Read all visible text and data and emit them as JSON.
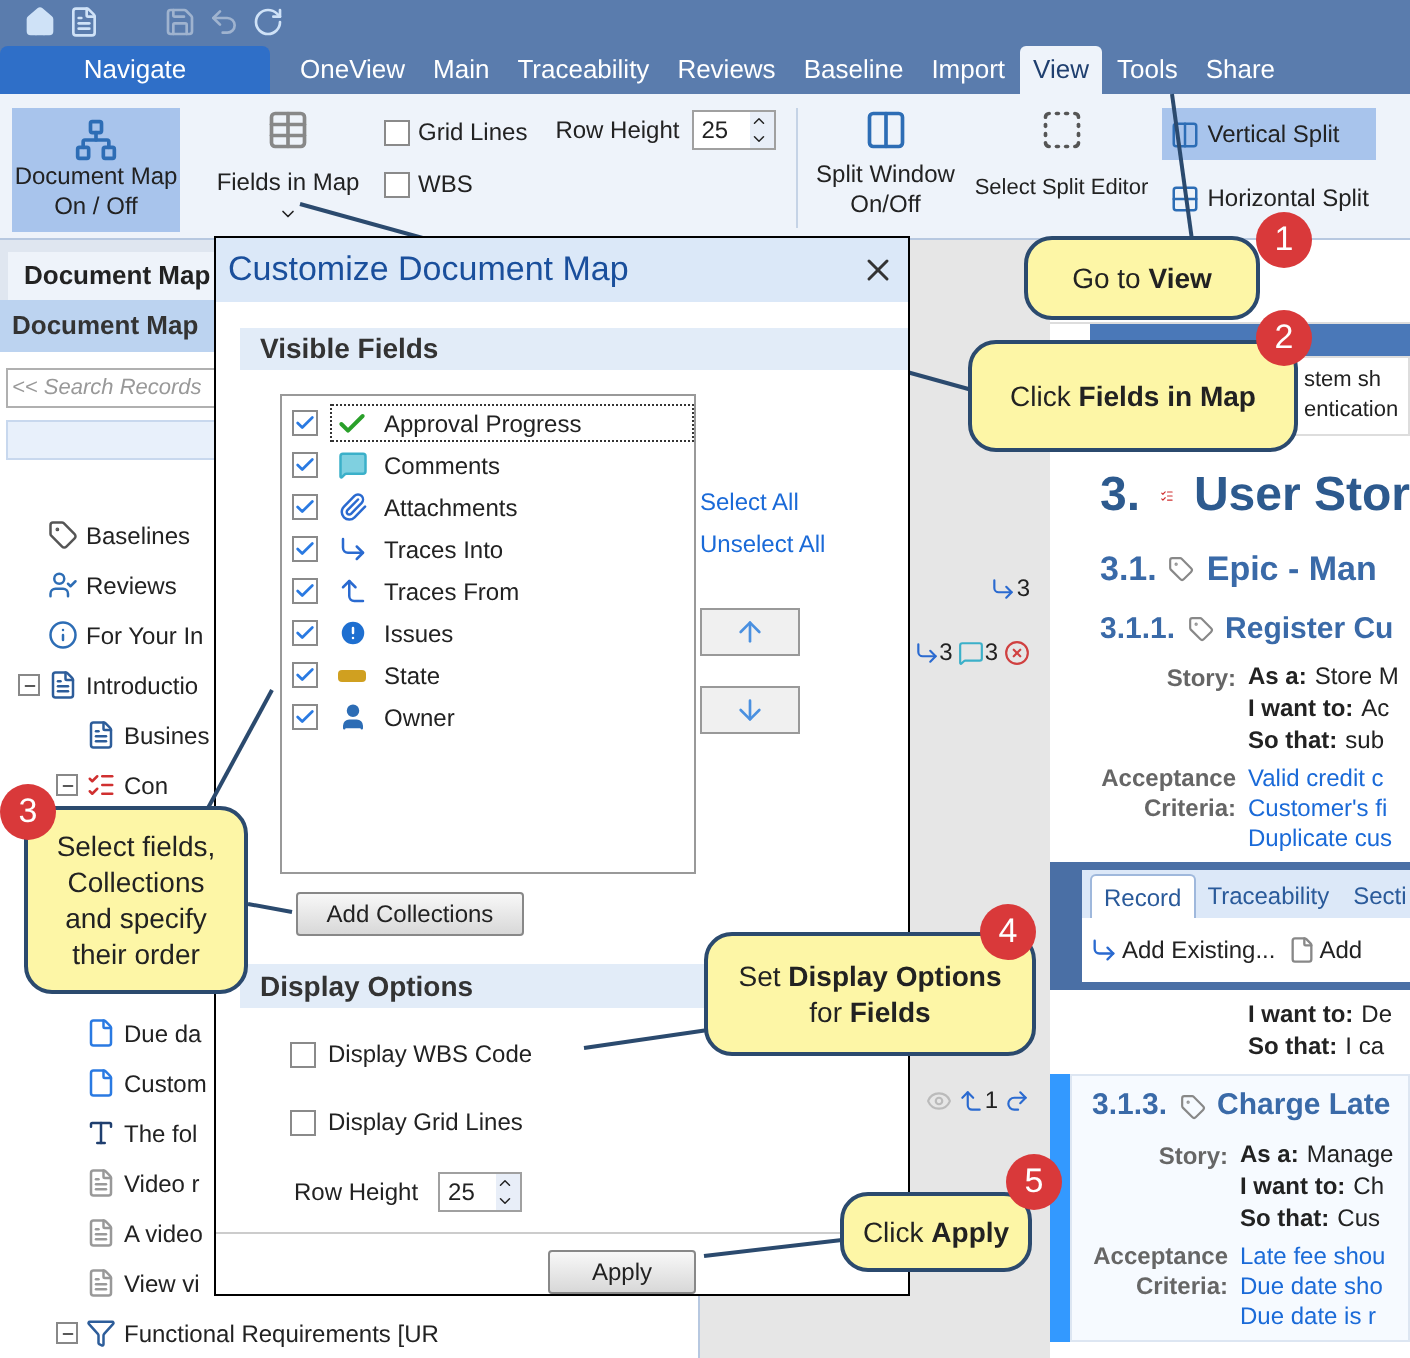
{
  "nav_button": {
    "label": "Navigate"
  },
  "tabs": [
    {
      "label": "OneView",
      "selected": false
    },
    {
      "label": "Main",
      "selected": false
    },
    {
      "label": "Traceability",
      "selected": false
    },
    {
      "label": "Reviews",
      "selected": false
    },
    {
      "label": "Baseline",
      "selected": false
    },
    {
      "label": "Import",
      "selected": false
    },
    {
      "label": "View",
      "selected": true
    },
    {
      "label": "Tools",
      "selected": false
    },
    {
      "label": "Share",
      "selected": false
    }
  ],
  "ribbon": {
    "document_map": {
      "label": "Document Map On / Off",
      "selected": true
    },
    "fields_in_map": {
      "label": "Fields in Map"
    },
    "checkboxes": [
      {
        "label": "Grid Lines",
        "checked": false
      },
      {
        "label": "WBS",
        "checked": false
      }
    ],
    "row_height": {
      "label": "Row Height",
      "value": "25"
    },
    "split_window": {
      "label": "Split Window On/Off"
    },
    "select_split_editor": {
      "label": "Select Split Editor"
    },
    "split_modes": [
      {
        "label": "Vertical Split",
        "selected": true
      },
      {
        "label": "Horizontal Split",
        "selected": false
      }
    ]
  },
  "document_map": {
    "tab": "Document Map",
    "title": "Document Map",
    "search": {
      "placeholder": "<< Search Records"
    },
    "tree_top": [
      {
        "label": "Baselines",
        "kind": "baseline"
      },
      {
        "label": "Reviews",
        "kind": "review"
      },
      {
        "label": "For Your In",
        "kind": "fyi"
      },
      {
        "label": "Introductio",
        "kind": "doc",
        "expanded": true,
        "children": [
          {
            "label": "Busines",
            "kind": "doc"
          },
          {
            "label": "Con",
            "kind": "checklist",
            "expanded": true
          }
        ]
      }
    ],
    "tree_bottom": [
      {
        "label": "Due da",
        "kind": "page"
      },
      {
        "label": "Custom",
        "kind": "page"
      },
      {
        "label": "The fol",
        "kind": "text"
      },
      {
        "label": "Video r",
        "kind": "note"
      },
      {
        "label": "A video",
        "kind": "note"
      },
      {
        "label": "View vi",
        "kind": "note"
      },
      {
        "label": "Functional Requirements [UR",
        "kind": "filter",
        "expanded": true
      }
    ]
  },
  "gutter_rows": [
    {
      "marks": [
        {
          "kind": "traces_into",
          "count": "3"
        }
      ]
    },
    {
      "marks": [
        {
          "kind": "traces_into",
          "count": "3"
        },
        {
          "kind": "comments",
          "count": "3"
        },
        {
          "kind": "refused"
        }
      ]
    },
    {
      "marks": [
        {
          "kind": "viewed"
        },
        {
          "kind": "traces_from",
          "count": "1"
        },
        {
          "kind": "redo"
        }
      ]
    }
  ],
  "document": {
    "table_fragments": [
      "stem sh",
      "entication"
    ],
    "heading": {
      "number": "3.",
      "title": "User Stor"
    },
    "epic": {
      "number": "3.1.",
      "title": "Epic - Man"
    },
    "story_1": {
      "number": "3.1.1.",
      "title": "Register Cu",
      "story_label": "Story:",
      "lines": [
        {
          "key": "As a:",
          "text": "Store M"
        },
        {
          "key": "I want to:",
          "text": "Ac"
        },
        {
          "key": "So that:",
          "text": "sub"
        }
      ],
      "criteria_label": "Acceptance Criteria:",
      "criteria": [
        "Valid credit c",
        "Customer's fi",
        "Duplicate cus"
      ]
    },
    "record_panel": {
      "tabs": [
        {
          "label": "Record",
          "selected": true
        },
        {
          "label": "Traceability",
          "selected": false
        },
        {
          "label": "Secti",
          "selected": false
        }
      ],
      "actions": [
        {
          "label": "Add Existing...",
          "kind": "trace"
        },
        {
          "label": "Add",
          "kind": "page"
        }
      ]
    },
    "story_2_lines": [
      {
        "key": "I want to:",
        "text": "De"
      },
      {
        "key": "So that:",
        "text": "I ca"
      }
    ],
    "story_3": {
      "number": "3.1.3.",
      "title": "Charge Late",
      "story_label": "Story:",
      "lines": [
        {
          "key": "As a:",
          "text": "Manage"
        },
        {
          "key": "I want to:",
          "text": "Ch"
        },
        {
          "key": "So that:",
          "text": "Cus"
        }
      ],
      "criteria_label": "Acceptance Criteria:",
      "criteria": [
        "Late fee shou",
        "Due date sho",
        "Due date is r"
      ]
    }
  },
  "dialog": {
    "title": "Customize Document Map",
    "visible_fields_title": "Visible Fields",
    "fields": [
      {
        "label": "Approval Progress",
        "kind": "approval",
        "checked": true,
        "focused": true
      },
      {
        "label": "Comments",
        "kind": "comments",
        "checked": true,
        "focused": false
      },
      {
        "label": "Attachments",
        "kind": "attachments",
        "checked": true,
        "focused": false
      },
      {
        "label": "Traces Into",
        "kind": "traces_into",
        "checked": true,
        "focused": false
      },
      {
        "label": "Traces From",
        "kind": "traces_from",
        "checked": true,
        "focused": false
      },
      {
        "label": "Issues",
        "kind": "issues",
        "checked": true,
        "focused": false
      },
      {
        "label": "State",
        "kind": "state",
        "checked": true,
        "focused": false
      },
      {
        "label": "Owner",
        "kind": "owner",
        "checked": true,
        "focused": false
      }
    ],
    "links": [
      "Select All",
      "Unselect All"
    ],
    "add_collections": "Add Collections",
    "display_options_title": "Display Options",
    "options": [
      {
        "label": "Display WBS Code",
        "checked": false
      },
      {
        "label": "Display Grid Lines",
        "checked": false
      }
    ],
    "row_height": {
      "label": "Row Height",
      "value": "25"
    },
    "apply": "Apply"
  },
  "callouts": [
    {
      "number": "1",
      "text": "Go to **View**"
    },
    {
      "number": "2",
      "text": "Click **Fields in Map**"
    },
    {
      "number": "3",
      "text": "Select fields, Collections and specify their order"
    },
    {
      "number": "4",
      "text": "Set **Display Options** for **Fields**"
    },
    {
      "number": "5",
      "text": "Click **Apply**"
    }
  ]
}
